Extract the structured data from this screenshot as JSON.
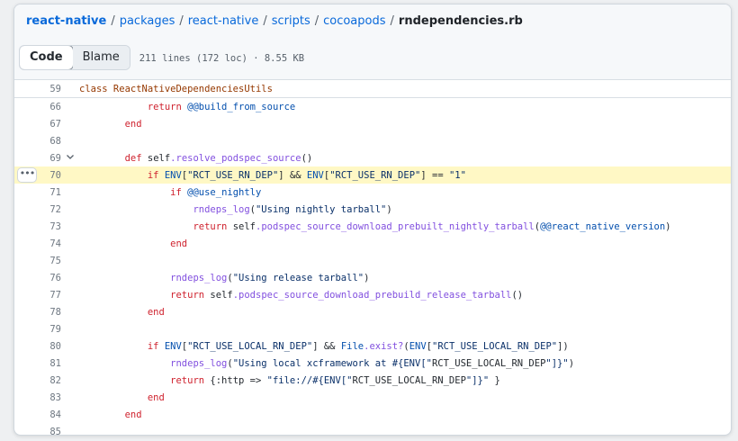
{
  "breadcrumb": {
    "repo": "react-native",
    "parts": [
      "packages",
      "react-native",
      "scripts",
      "cocoapods"
    ],
    "file": "rndependencies.rb",
    "separator": "/"
  },
  "toolbar": {
    "code_label": "Code",
    "blame_label": "Blame",
    "file_info": "211 lines (172 loc) · 8.55 KB"
  },
  "sticky": {
    "line_number": "59",
    "text": "class ReactNativeDependenciesUtils"
  },
  "icons": {
    "fold": "chevron-down-icon",
    "menu": "kebab-horizontal-icon"
  },
  "colors": {
    "link": "#0969da",
    "highlight": "#fff8c5",
    "keyword": "#cf222e",
    "string": "#0a3069",
    "function": "#8250df"
  },
  "code": {
    "lines": [
      {
        "n": "66",
        "text": "            return @@build_from_source"
      },
      {
        "n": "67",
        "text": "        end"
      },
      {
        "n": "68",
        "text": ""
      },
      {
        "n": "69",
        "text": "        def self.resolve_podspec_source()",
        "fold": true
      },
      {
        "n": "70",
        "text": "            if ENV[\"RCT_USE_RN_DEP\"] && ENV[\"RCT_USE_RN_DEP\"] == \"1\"",
        "highlight": true
      },
      {
        "n": "71",
        "text": "                if @@use_nightly"
      },
      {
        "n": "72",
        "text": "                    rndeps_log(\"Using nightly tarball\")"
      },
      {
        "n": "73",
        "text": "                    return self.podspec_source_download_prebuilt_nightly_tarball(@@react_native_version)"
      },
      {
        "n": "74",
        "text": "                end"
      },
      {
        "n": "75",
        "text": ""
      },
      {
        "n": "76",
        "text": "                rndeps_log(\"Using release tarball\")"
      },
      {
        "n": "77",
        "text": "                return self.podspec_source_download_prebuild_release_tarball()"
      },
      {
        "n": "78",
        "text": "            end"
      },
      {
        "n": "79",
        "text": ""
      },
      {
        "n": "80",
        "text": "            if ENV[\"RCT_USE_LOCAL_RN_DEP\"] && File.exist?(ENV[\"RCT_USE_LOCAL_RN_DEP\"])"
      },
      {
        "n": "81",
        "text": "                rndeps_log(\"Using local xcframework at #{ENV[\"RCT_USE_LOCAL_RN_DEP\"]}\")"
      },
      {
        "n": "82",
        "text": "                return {:http => \"file://#{ENV[\"RCT_USE_LOCAL_RN_DEP\"]}\" }"
      },
      {
        "n": "83",
        "text": "            end"
      },
      {
        "n": "84",
        "text": "        end"
      },
      {
        "n": "85",
        "text": ""
      }
    ]
  }
}
